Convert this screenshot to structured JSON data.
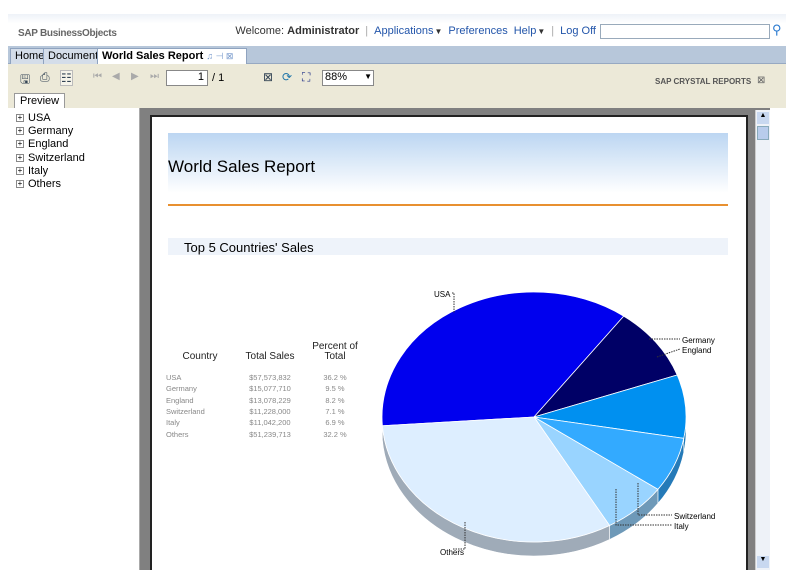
{
  "header": {
    "logo": "SAP BusinessObjects",
    "welcome": "Welcome:",
    "user": "Administrator",
    "nav": [
      "Applications",
      "Preferences",
      "Help",
      "Log Off"
    ],
    "search_value": ""
  },
  "tabs": [
    "Home",
    "Documents",
    "World Sales Report"
  ],
  "toolbar": {
    "page": "1",
    "page_total": "/ 1",
    "zoom": "88%",
    "brand": "SAP CRYSTAL REPORTS",
    "preview_tab": "Preview"
  },
  "tree": [
    "USA",
    "Germany",
    "England",
    "Switzerland",
    "Italy",
    "Others"
  ],
  "report": {
    "title": "World Sales Report",
    "subtitle": "Top  5 Countries' Sales",
    "columns": [
      "Country",
      "Total Sales",
      "Percent of Total"
    ],
    "rows": [
      [
        "USA",
        "$57,573,832",
        "36.2 %"
      ],
      [
        "Germany",
        "$15,077,710",
        "9.5 %"
      ],
      [
        "England",
        "$13,078,229",
        "8.2 %"
      ],
      [
        "Switzerland",
        "$11,228,000",
        "7.1 %"
      ],
      [
        "Italy",
        "$11,042,200",
        "6.9 %"
      ],
      [
        "Others",
        "$51,239,713",
        "32.2 %"
      ]
    ]
  },
  "chart_data": {
    "type": "pie",
    "categories": [
      "USA",
      "Germany",
      "England",
      "Switzerland",
      "Italy",
      "Others"
    ],
    "values": [
      36.2,
      9.5,
      8.2,
      7.1,
      6.9,
      32.2
    ],
    "colors": [
      "#0000ee",
      "#000066",
      "#0090f0",
      "#33aaff",
      "#99d4ff",
      "#ddeeff"
    ]
  }
}
